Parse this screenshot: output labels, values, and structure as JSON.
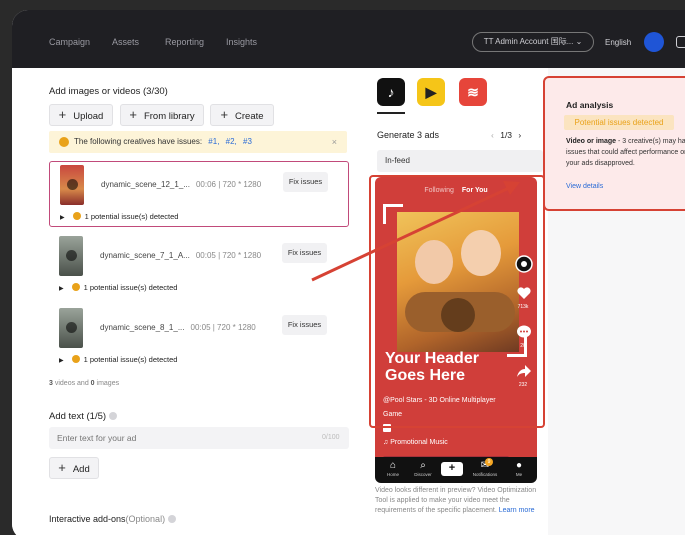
{
  "topbar": {
    "nav": [
      "Campaign",
      "Assets",
      "Reporting",
      "Insights"
    ],
    "account": "TT Admin Account 国际... ⌄",
    "language": "English"
  },
  "creatives": {
    "title": "Add images or videos (3/30)",
    "buttons": {
      "upload": "Upload",
      "from_library": "From library",
      "create": "Create"
    },
    "warning": {
      "text": "The following creatives have issues:",
      "links": [
        "#1,",
        "#2,",
        "#3"
      ],
      "close": "×"
    },
    "items": [
      {
        "name": "dynamic_scene_12_1_...",
        "meta": "00:06  |  720 * 1280",
        "fix": "Fix issues",
        "issue": "1 potential issue(s) detected"
      },
      {
        "name": "dynamic_scene_7_1_A...",
        "meta": "00:05  |  720 * 1280",
        "fix": "Fix issues",
        "issue": "1 potential issue(s) detected"
      },
      {
        "name": "dynamic_scene_8_1_...",
        "meta": "00:05  |  720 * 1280",
        "fix": "Fix issues",
        "issue": "1 potential issue(s) detected"
      }
    ],
    "counts": {
      "videos": "3",
      "videos_label": "videos and",
      "images": "0",
      "images_label": "images"
    }
  },
  "ad_text": {
    "title": "Add text (1/5)",
    "placeholder": "Enter text for your ad",
    "count": "0/100",
    "add": "Add"
  },
  "addons": {
    "title": "Interactive add-ons",
    "suffix": "(Optional)"
  },
  "preview": {
    "platforms": [
      "tiktok-logo",
      "pangle-logo",
      "topbuzz-logo"
    ],
    "generate": "Generate 3 ads",
    "pager": {
      "prev": "‹",
      "page": "1/3",
      "next": "›"
    },
    "placement": "In-feed",
    "phone": {
      "tab_following": "Following",
      "tab_for_you": "For You",
      "header": "Your Header Goes Here",
      "handle": "@Pool Stars - 3D Online Multiplayer Game",
      "music": "♫ Promotional Music",
      "cta": "›",
      "like_count": "713k",
      "comment_count": "20",
      "share_count": "232",
      "nav": [
        "Home",
        "Discover",
        "Notifications",
        "Me"
      ],
      "badge": "9"
    },
    "note": "Video looks different in preview? Video Optimization Tool is applied to make your video meet the requirements of the specific placement.",
    "note_link": "Learn more"
  },
  "analysis": {
    "title": "Ad analysis",
    "status": "Potential issues detected",
    "desc_bold": "Video or image",
    "desc": " - 3 creative(s) may have issues that could affect performance or get your ads disapproved.",
    "link": "View details"
  },
  "colors": {
    "accent_red": "#d64234",
    "warning": "#e9a21a",
    "link": "#2a6bd6",
    "phone_bg": "#d03e3a"
  }
}
